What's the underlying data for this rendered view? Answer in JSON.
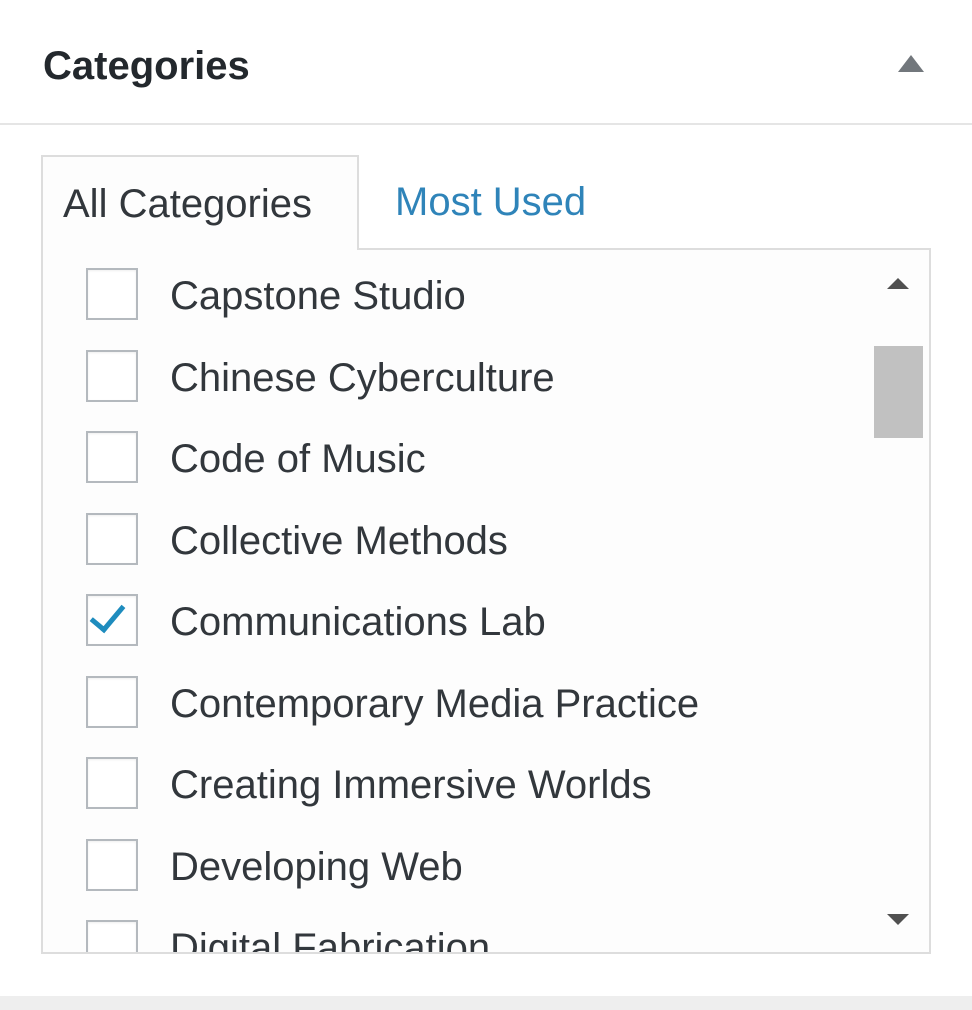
{
  "panel": {
    "title": "Categories",
    "toggle_icon": "triangle-up-icon"
  },
  "tabs": [
    {
      "label": "All Categories",
      "active": true
    },
    {
      "label": "Most Used",
      "active": false
    }
  ],
  "categories": [
    {
      "label": "Capstone Studio",
      "checked": false
    },
    {
      "label": "Chinese Cyberculture",
      "checked": false
    },
    {
      "label": "Code of Music",
      "checked": false
    },
    {
      "label": "Collective Methods",
      "checked": false
    },
    {
      "label": "Communications Lab",
      "checked": true
    },
    {
      "label": "Contemporary Media Practice",
      "checked": false
    },
    {
      "label": "Creating Immersive Worlds",
      "checked": false
    },
    {
      "label": "Developing Web",
      "checked": false
    },
    {
      "label": "Digital Fabrication",
      "checked": false
    }
  ],
  "scrollbar": {
    "up_icon": "scroll-up-arrow-icon",
    "down_icon": "scroll-down-arrow-icon",
    "position_fraction": 0.12
  },
  "colors": {
    "accent_link": "#2f84b9",
    "checkmark": "#1e8cbe",
    "text": "#32373c",
    "title": "#23282d",
    "border": "#dddddd"
  }
}
